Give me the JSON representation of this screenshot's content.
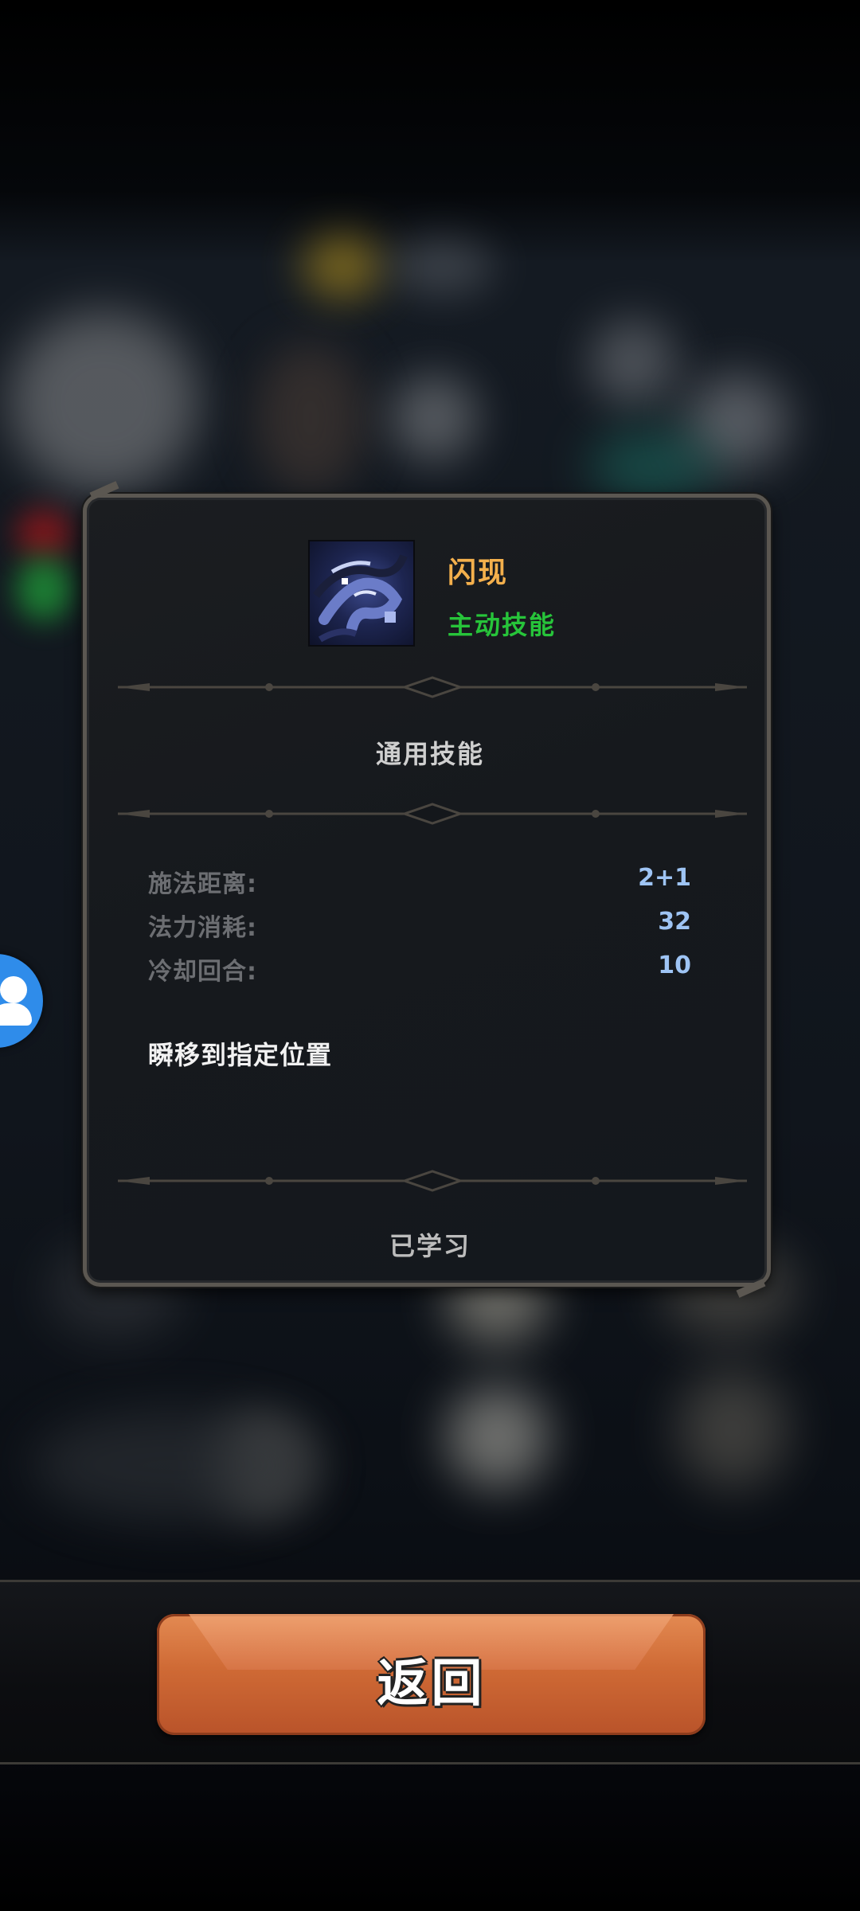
{
  "skill": {
    "name": "闪现",
    "type": "主动技能",
    "category": "通用技能",
    "icon": "blink-skill-icon",
    "name_color": "#f4b04c",
    "type_color": "#27c43a"
  },
  "stats": {
    "range_label": "施法距离:",
    "range_value": "2+1",
    "mana_label": "法力消耗:",
    "mana_value": "32",
    "cooldown_label": "冷却回合:",
    "cooldown_value": "10",
    "value_color": "#9ec4f4"
  },
  "description": "瞬移到指定位置",
  "learn_status": "已学习",
  "back_button": {
    "label": "返回",
    "color": "#cf6a35"
  },
  "side_bubble": {
    "icon": "user-icon",
    "color": "#2f8cea"
  }
}
